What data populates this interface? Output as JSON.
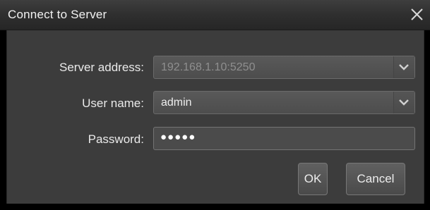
{
  "dialog": {
    "title": "Connect to Server",
    "close_icon": "close-icon"
  },
  "form": {
    "server_address": {
      "label": "Server address:",
      "value": "192.168.1.10:5250",
      "enabled": false
    },
    "user_name": {
      "label": "User name:",
      "value": "admin",
      "enabled": true
    },
    "password": {
      "label": "Password:",
      "masked_value": "●●●●●"
    }
  },
  "buttons": {
    "ok_label": "OK",
    "cancel_label": "Cancel"
  },
  "icons": {
    "dropdown": "chevron-down-icon"
  },
  "colors": {
    "window_bg": "#000000",
    "client_bg": "#3c3c3c",
    "field_bg": "#4d4d4d",
    "text": "#eaeaea"
  }
}
